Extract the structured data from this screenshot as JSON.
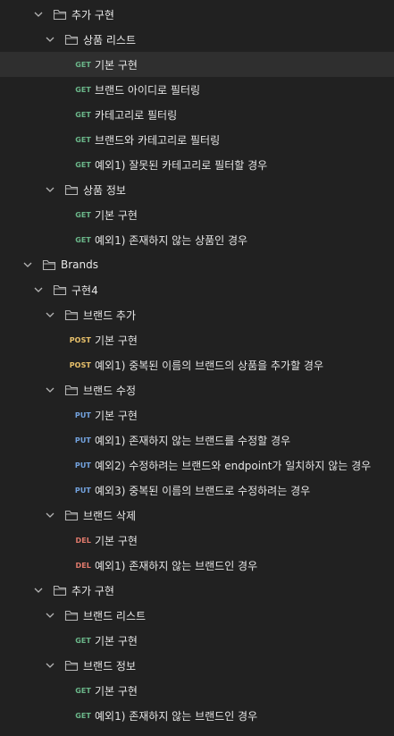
{
  "colors": {
    "get": "#6bb78a",
    "post": "#e8c16b",
    "put": "#74a4e0",
    "del": "#e07a6c",
    "icon": "#b5b5b5",
    "selected_row": "#2f2f2f"
  },
  "icons": {
    "chevron": "chevron-down-icon",
    "folder": "folder-icon"
  },
  "rows": [
    {
      "type": "folder",
      "depth": 1,
      "label": "추가 구현"
    },
    {
      "type": "folder",
      "depth": 2,
      "label": "상품 리스트"
    },
    {
      "type": "request",
      "depth": 3,
      "method": "GET",
      "label": "기본 구현",
      "selected": true
    },
    {
      "type": "request",
      "depth": 3,
      "method": "GET",
      "label": "브랜드 아이디로 필터링"
    },
    {
      "type": "request",
      "depth": 3,
      "method": "GET",
      "label": "카테고리로 필터링"
    },
    {
      "type": "request",
      "depth": 3,
      "method": "GET",
      "label": "브랜드와 카테고리로 필터링"
    },
    {
      "type": "request",
      "depth": 3,
      "method": "GET",
      "label": "예외1) 잘못된 카테고리로 필터할 경우"
    },
    {
      "type": "folder",
      "depth": 2,
      "label": "상품 정보"
    },
    {
      "type": "request",
      "depth": 3,
      "method": "GET",
      "label": "기본 구현"
    },
    {
      "type": "request",
      "depth": 3,
      "method": "GET",
      "label": "예외1) 존재하지 않는 상품인 경우"
    },
    {
      "type": "folder",
      "depth": 0,
      "label": "Brands"
    },
    {
      "type": "folder",
      "depth": 1,
      "label": "구현4"
    },
    {
      "type": "folder",
      "depth": 2,
      "label": "브랜드 추가"
    },
    {
      "type": "request",
      "depth": 3,
      "method": "POST",
      "label": "기본 구현"
    },
    {
      "type": "request",
      "depth": 3,
      "method": "POST",
      "label": "예외1) 중복된 이름의 브랜드의 상품을 추가할 경우"
    },
    {
      "type": "folder",
      "depth": 2,
      "label": "브랜드 수정"
    },
    {
      "type": "request",
      "depth": 3,
      "method": "PUT",
      "label": "기본 구현"
    },
    {
      "type": "request",
      "depth": 3,
      "method": "PUT",
      "label": "예외1) 존재하지 않는 브랜드를 수정할 경우"
    },
    {
      "type": "request",
      "depth": 3,
      "method": "PUT",
      "label": "예외2) 수정하려는 브랜드와 endpoint가 일치하지 않는 경우"
    },
    {
      "type": "request",
      "depth": 3,
      "method": "PUT",
      "label": "예외3) 중복된 이름의 브랜드로 수정하려는 경우"
    },
    {
      "type": "folder",
      "depth": 2,
      "label": "브랜드 삭제"
    },
    {
      "type": "request",
      "depth": 3,
      "method": "DEL",
      "label": "기본 구현"
    },
    {
      "type": "request",
      "depth": 3,
      "method": "DEL",
      "label": "예외1) 존재하지 않는 브랜드인 경우"
    },
    {
      "type": "folder",
      "depth": 1,
      "label": "추가 구현"
    },
    {
      "type": "folder",
      "depth": 2,
      "label": "브랜드 리스트"
    },
    {
      "type": "request",
      "depth": 3,
      "method": "GET",
      "label": "기본 구현"
    },
    {
      "type": "folder",
      "depth": 2,
      "label": "브랜드 정보"
    },
    {
      "type": "request",
      "depth": 3,
      "method": "GET",
      "label": "기본 구현"
    },
    {
      "type": "request",
      "depth": 3,
      "method": "GET",
      "label": "예외1) 존재하지 않는 브랜드인 경우"
    }
  ]
}
